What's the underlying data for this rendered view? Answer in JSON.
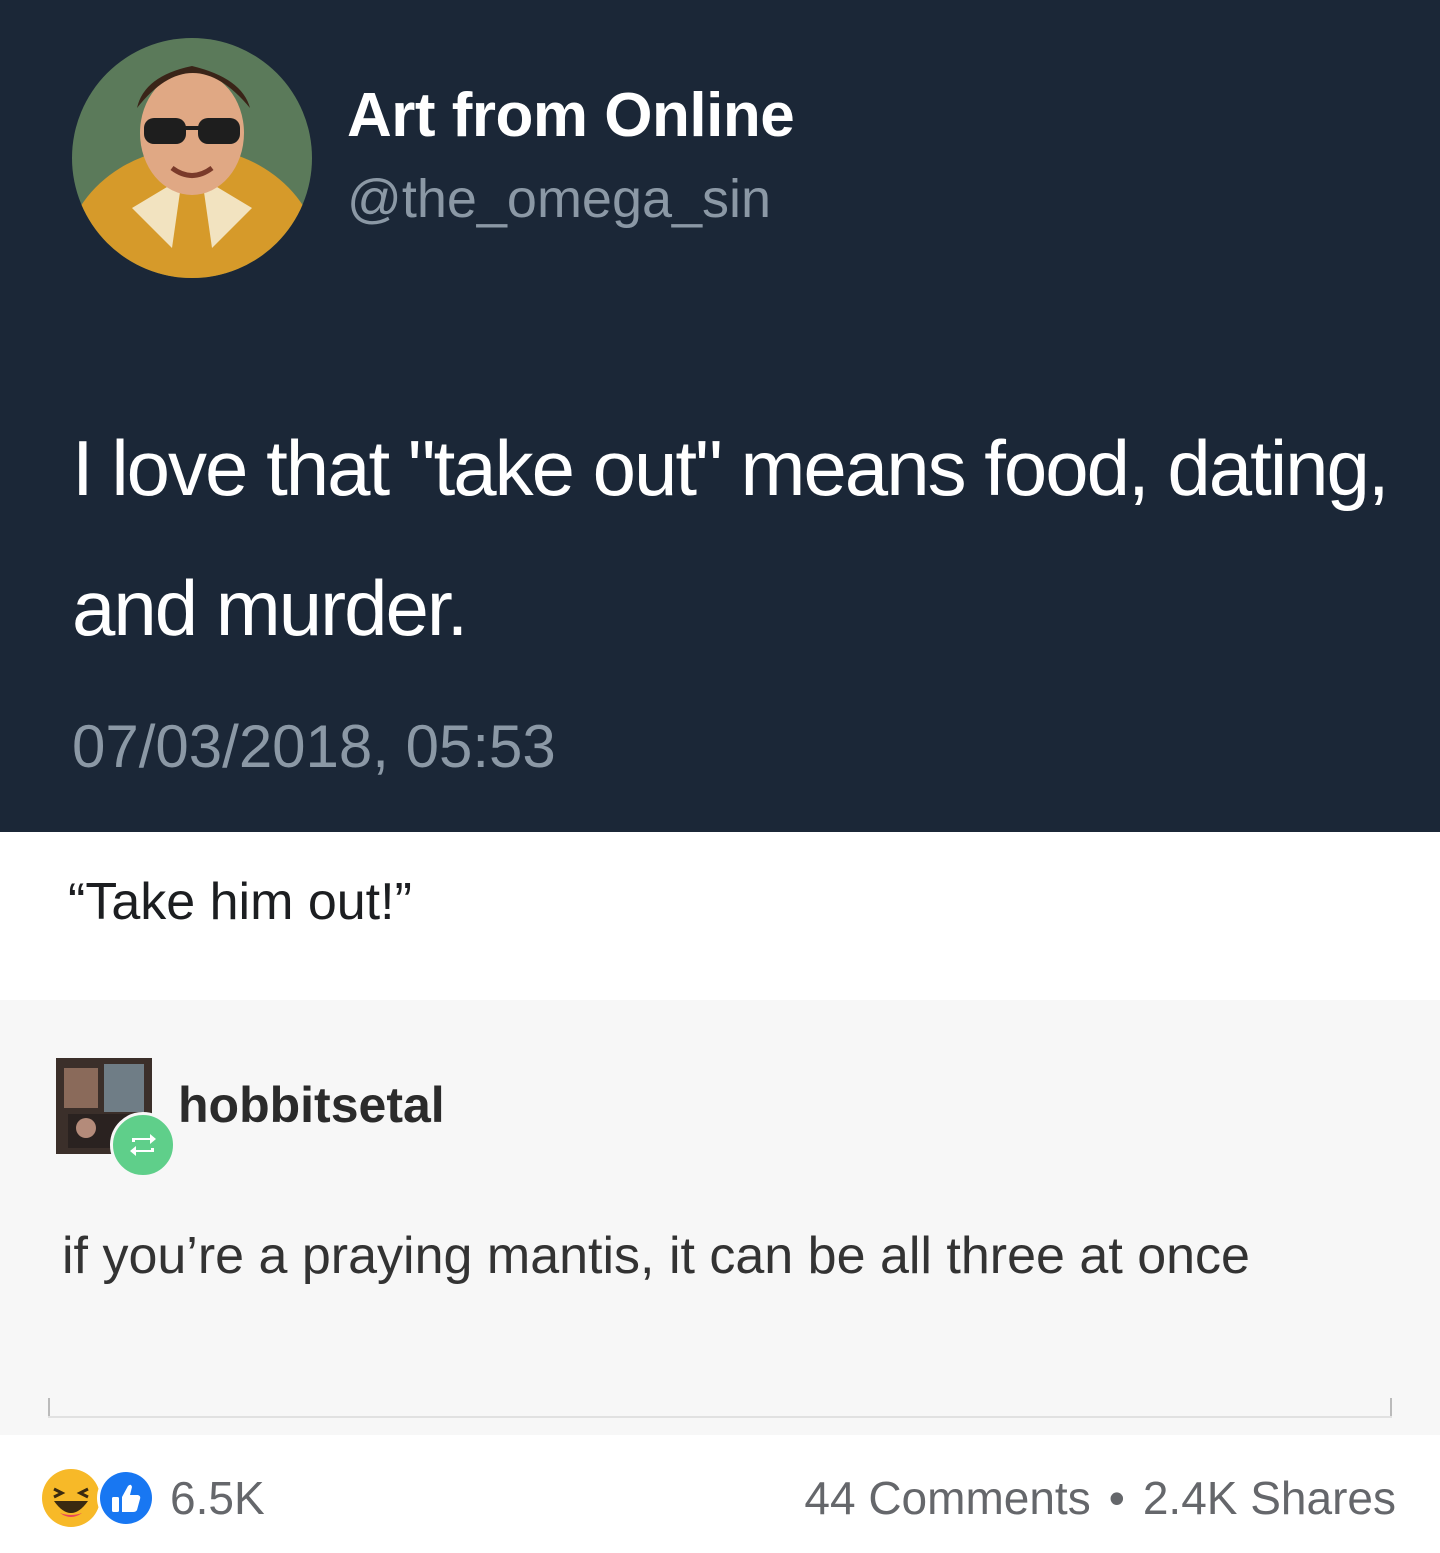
{
  "tweet": {
    "display_name": "Art from Online",
    "handle": "@the_omega_sin",
    "text": "I love that \"take out\" means food, dating, and murder.",
    "timestamp": "07/03/2018, 05:53"
  },
  "caption": {
    "text": "“Take him out!”"
  },
  "reply": {
    "username": "hobbitsetal",
    "text": "if you’re a praying mantis, it can be all three at once"
  },
  "footer": {
    "reaction_count": "6.5K",
    "comments": "44 Comments",
    "separator": "•",
    "shares": "2.4K Shares"
  },
  "icons": [
    "avatar-portrait",
    "reblog-icon",
    "haha-reaction-icon",
    "like-reaction-icon"
  ],
  "colors": {
    "tweet_bg": "#1b2737",
    "muted_text": "#8b98a5",
    "reblog_green": "#5fcf8a",
    "like_blue": "#1877f2",
    "haha_yellow": "#f7b928"
  }
}
